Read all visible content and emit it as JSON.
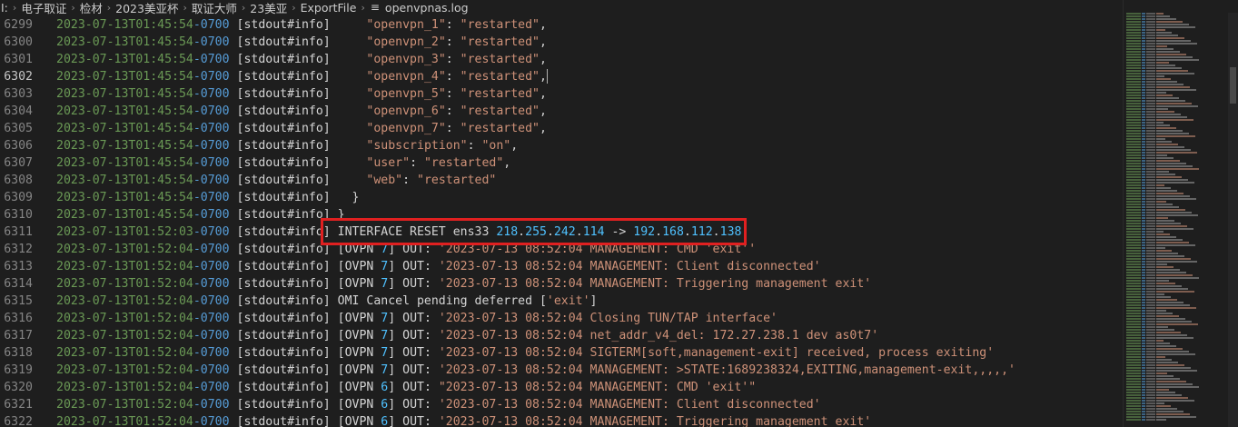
{
  "breadcrumb": {
    "items": [
      "I:",
      "电子取证",
      "检材",
      "2023美亚杯",
      "取证大师",
      "23美亚",
      "ExportFile"
    ],
    "file_icon": "lines-file-icon",
    "file_name": "openvpnas.log"
  },
  "editor": {
    "active_line": "6302",
    "lines": [
      {
        "n": "6299",
        "date": "2023-07-13T01:45:54",
        "tz": "-0700",
        "tag": " [stdout#info]",
        "rest": [
          {
            "c": "txt",
            "t": "     "
          },
          {
            "c": "str",
            "t": "\"openvpn_1\""
          },
          {
            "c": "txt",
            "t": ": "
          },
          {
            "c": "str",
            "t": "\"restarted\""
          },
          {
            "c": "txt",
            "t": ","
          }
        ]
      },
      {
        "n": "6300",
        "date": "2023-07-13T01:45:54",
        "tz": "-0700",
        "tag": " [stdout#info]",
        "rest": [
          {
            "c": "txt",
            "t": "     "
          },
          {
            "c": "str",
            "t": "\"openvpn_2\""
          },
          {
            "c": "txt",
            "t": ": "
          },
          {
            "c": "str",
            "t": "\"restarted\""
          },
          {
            "c": "txt",
            "t": ","
          }
        ]
      },
      {
        "n": "6301",
        "date": "2023-07-13T01:45:54",
        "tz": "-0700",
        "tag": " [stdout#info]",
        "rest": [
          {
            "c": "txt",
            "t": "     "
          },
          {
            "c": "str",
            "t": "\"openvpn_3\""
          },
          {
            "c": "txt",
            "t": ": "
          },
          {
            "c": "str",
            "t": "\"restarted\""
          },
          {
            "c": "txt",
            "t": ","
          }
        ]
      },
      {
        "n": "6302",
        "date": "2023-07-13T01:45:54",
        "tz": "-0700",
        "tag": " [stdout#info]",
        "rest": [
          {
            "c": "txt",
            "t": "     "
          },
          {
            "c": "str",
            "t": "\"openvpn_4\""
          },
          {
            "c": "txt",
            "t": ": "
          },
          {
            "c": "str",
            "t": "\"restarted\""
          },
          {
            "c": "txt",
            "t": ","
          }
        ],
        "cursor": true
      },
      {
        "n": "6303",
        "date": "2023-07-13T01:45:54",
        "tz": "-0700",
        "tag": " [stdout#info]",
        "rest": [
          {
            "c": "txt",
            "t": "     "
          },
          {
            "c": "str",
            "t": "\"openvpn_5\""
          },
          {
            "c": "txt",
            "t": ": "
          },
          {
            "c": "str",
            "t": "\"restarted\""
          },
          {
            "c": "txt",
            "t": ","
          }
        ]
      },
      {
        "n": "6304",
        "date": "2023-07-13T01:45:54",
        "tz": "-0700",
        "tag": " [stdout#info]",
        "rest": [
          {
            "c": "txt",
            "t": "     "
          },
          {
            "c": "str",
            "t": "\"openvpn_6\""
          },
          {
            "c": "txt",
            "t": ": "
          },
          {
            "c": "str",
            "t": "\"restarted\""
          },
          {
            "c": "txt",
            "t": ","
          }
        ]
      },
      {
        "n": "6305",
        "date": "2023-07-13T01:45:54",
        "tz": "-0700",
        "tag": " [stdout#info]",
        "rest": [
          {
            "c": "txt",
            "t": "     "
          },
          {
            "c": "str",
            "t": "\"openvpn_7\""
          },
          {
            "c": "txt",
            "t": ": "
          },
          {
            "c": "str",
            "t": "\"restarted\""
          },
          {
            "c": "txt",
            "t": ","
          }
        ]
      },
      {
        "n": "6306",
        "date": "2023-07-13T01:45:54",
        "tz": "-0700",
        "tag": " [stdout#info]",
        "rest": [
          {
            "c": "txt",
            "t": "     "
          },
          {
            "c": "str",
            "t": "\"subscription\""
          },
          {
            "c": "txt",
            "t": ": "
          },
          {
            "c": "str",
            "t": "\"on\""
          },
          {
            "c": "txt",
            "t": ","
          }
        ]
      },
      {
        "n": "6307",
        "date": "2023-07-13T01:45:54",
        "tz": "-0700",
        "tag": " [stdout#info]",
        "rest": [
          {
            "c": "txt",
            "t": "     "
          },
          {
            "c": "str",
            "t": "\"user\""
          },
          {
            "c": "txt",
            "t": ": "
          },
          {
            "c": "str",
            "t": "\"restarted\""
          },
          {
            "c": "txt",
            "t": ","
          }
        ]
      },
      {
        "n": "6308",
        "date": "2023-07-13T01:45:54",
        "tz": "-0700",
        "tag": " [stdout#info]",
        "rest": [
          {
            "c": "txt",
            "t": "     "
          },
          {
            "c": "str",
            "t": "\"web\""
          },
          {
            "c": "txt",
            "t": ": "
          },
          {
            "c": "str",
            "t": "\"restarted\""
          }
        ]
      },
      {
        "n": "6309",
        "date": "2023-07-13T01:45:54",
        "tz": "-0700",
        "tag": " [stdout#info]",
        "rest": [
          {
            "c": "txt",
            "t": "   }"
          }
        ]
      },
      {
        "n": "6310",
        "date": "2023-07-13T01:45:54",
        "tz": "-0700",
        "tag": " [stdout#info]",
        "rest": [
          {
            "c": "txt",
            "t": " }"
          }
        ]
      },
      {
        "n": "6311",
        "date": "2023-07-13T01:52:03",
        "tz": "-0700",
        "tag": " [stdout#info]",
        "rest": [
          {
            "c": "txt",
            "t": " INTERFACE RESET ens33 "
          },
          {
            "c": "num",
            "t": "218"
          },
          {
            "c": "txt",
            "t": "."
          },
          {
            "c": "num",
            "t": "255"
          },
          {
            "c": "txt",
            "t": "."
          },
          {
            "c": "num",
            "t": "242"
          },
          {
            "c": "txt",
            "t": "."
          },
          {
            "c": "num",
            "t": "114"
          },
          {
            "c": "txt",
            "t": " -> "
          },
          {
            "c": "num",
            "t": "192"
          },
          {
            "c": "txt",
            "t": "."
          },
          {
            "c": "num",
            "t": "168"
          },
          {
            "c": "txt",
            "t": "."
          },
          {
            "c": "num",
            "t": "112"
          },
          {
            "c": "txt",
            "t": "."
          },
          {
            "c": "num",
            "t": "138"
          }
        ]
      },
      {
        "n": "6312",
        "date": "2023-07-13T01:52:04",
        "tz": "-0700",
        "tag": " [stdout#info]",
        "rest": [
          {
            "c": "txt",
            "t": " [OVPN "
          },
          {
            "c": "num",
            "t": "7"
          },
          {
            "c": "txt",
            "t": "] OUT: "
          },
          {
            "c": "str",
            "t": "'2023-07-13 08:52:04 MANAGEMENT: CMD 'exit''"
          }
        ]
      },
      {
        "n": "6313",
        "date": "2023-07-13T01:52:04",
        "tz": "-0700",
        "tag": " [stdout#info]",
        "rest": [
          {
            "c": "txt",
            "t": " [OVPN "
          },
          {
            "c": "num",
            "t": "7"
          },
          {
            "c": "txt",
            "t": "] OUT: "
          },
          {
            "c": "str",
            "t": "'2023-07-13 08:52:04 MANAGEMENT: Client disconnected'"
          }
        ]
      },
      {
        "n": "6314",
        "date": "2023-07-13T01:52:04",
        "tz": "-0700",
        "tag": " [stdout#info]",
        "rest": [
          {
            "c": "txt",
            "t": " [OVPN "
          },
          {
            "c": "num",
            "t": "7"
          },
          {
            "c": "txt",
            "t": "] OUT: "
          },
          {
            "c": "str",
            "t": "'2023-07-13 08:52:04 MANAGEMENT: Triggering management exit'"
          }
        ]
      },
      {
        "n": "6315",
        "date": "2023-07-13T01:52:04",
        "tz": "-0700",
        "tag": " [stdout#info]",
        "rest": [
          {
            "c": "txt",
            "t": " OMI Cancel pending deferred ["
          },
          {
            "c": "str",
            "t": "'exit'"
          },
          {
            "c": "txt",
            "t": "]"
          }
        ]
      },
      {
        "n": "6316",
        "date": "2023-07-13T01:52:04",
        "tz": "-0700",
        "tag": " [stdout#info]",
        "rest": [
          {
            "c": "txt",
            "t": " [OVPN "
          },
          {
            "c": "num",
            "t": "7"
          },
          {
            "c": "txt",
            "t": "] OUT: "
          },
          {
            "c": "str",
            "t": "'2023-07-13 08:52:04 Closing TUN/TAP interface'"
          }
        ]
      },
      {
        "n": "6317",
        "date": "2023-07-13T01:52:04",
        "tz": "-0700",
        "tag": " [stdout#info]",
        "rest": [
          {
            "c": "txt",
            "t": " [OVPN "
          },
          {
            "c": "num",
            "t": "7"
          },
          {
            "c": "txt",
            "t": "] OUT: "
          },
          {
            "c": "str",
            "t": "'2023-07-13 08:52:04 net_addr_v4_del: 172.27.238.1 dev as0t7'"
          }
        ]
      },
      {
        "n": "6318",
        "date": "2023-07-13T01:52:04",
        "tz": "-0700",
        "tag": " [stdout#info]",
        "rest": [
          {
            "c": "txt",
            "t": " [OVPN "
          },
          {
            "c": "num",
            "t": "7"
          },
          {
            "c": "txt",
            "t": "] OUT: "
          },
          {
            "c": "str",
            "t": "'2023-07-13 08:52:04 SIGTERM[soft,management-exit] received, process exiting'"
          }
        ]
      },
      {
        "n": "6319",
        "date": "2023-07-13T01:52:04",
        "tz": "-0700",
        "tag": " [stdout#info]",
        "rest": [
          {
            "c": "txt",
            "t": " [OVPN "
          },
          {
            "c": "num",
            "t": "7"
          },
          {
            "c": "txt",
            "t": "] OUT: "
          },
          {
            "c": "str",
            "t": "'2023-07-13 08:52:04 MANAGEMENT: >STATE:1689238324,EXITING,management-exit,,,,,'"
          }
        ]
      },
      {
        "n": "6320",
        "date": "2023-07-13T01:52:04",
        "tz": "-0700",
        "tag": " [stdout#info]",
        "rest": [
          {
            "c": "txt",
            "t": " [OVPN "
          },
          {
            "c": "num",
            "t": "6"
          },
          {
            "c": "txt",
            "t": "] OUT: "
          },
          {
            "c": "str",
            "t": "\"2023-07-13 08:52:04 MANAGEMENT: CMD 'exit'\""
          }
        ]
      },
      {
        "n": "6321",
        "date": "2023-07-13T01:52:04",
        "tz": "-0700",
        "tag": " [stdout#info]",
        "rest": [
          {
            "c": "txt",
            "t": " [OVPN "
          },
          {
            "c": "num",
            "t": "6"
          },
          {
            "c": "txt",
            "t": "] OUT: "
          },
          {
            "c": "str",
            "t": "'2023-07-13 08:52:04 MANAGEMENT: Client disconnected'"
          }
        ]
      },
      {
        "n": "6322",
        "date": "2023-07-13T01:52:04",
        "tz": "-0700",
        "tag": " [stdout#info]",
        "rest": [
          {
            "c": "txt",
            "t": " [OVPN "
          },
          {
            "c": "num",
            "t": "6"
          },
          {
            "c": "txt",
            "t": "] OUT: "
          },
          {
            "c": "str",
            "t": "'2023-07-13 08:52:04 MANAGEMENT: Triggering management exit'"
          }
        ]
      }
    ]
  },
  "colors": {
    "background": "#1e1e1e",
    "date": "#6a9955",
    "timezone": "#569cd6",
    "string": "#ce9178",
    "number": "#4fc1ff",
    "text": "#d4d4d4",
    "highlight_box": "#e02020"
  }
}
